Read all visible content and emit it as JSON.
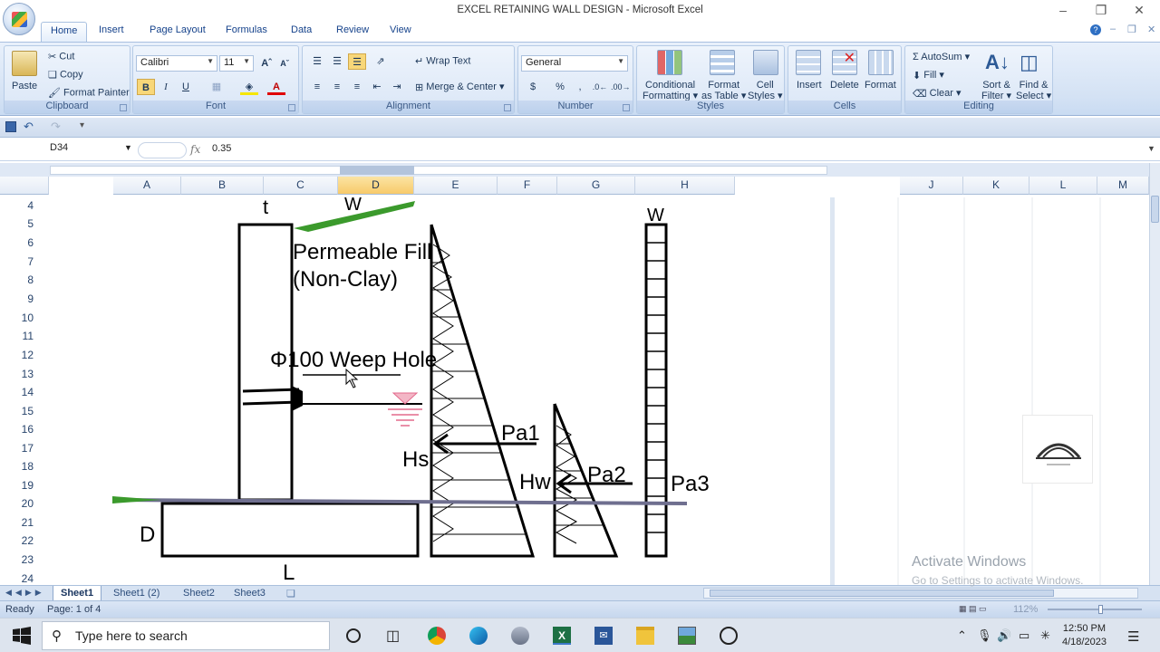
{
  "window": {
    "title": "EXCEL RETAINING WALL DESIGN - Microsoft Excel"
  },
  "ribbon_tabs": [
    "Home",
    "Insert",
    "Page Layout",
    "Formulas",
    "Data",
    "Review",
    "View"
  ],
  "clipboard": {
    "paste": "Paste",
    "cut": "Cut",
    "copy": "Copy",
    "format_painter": "Format Painter",
    "label": "Clipboard"
  },
  "font": {
    "name": "Calibri",
    "size": "11",
    "label": "Font",
    "bold": "B",
    "italic": "I",
    "underline": "U"
  },
  "alignment": {
    "wrap_text": "Wrap Text",
    "merge_center": "Merge & Center",
    "label": "Alignment"
  },
  "number": {
    "format": "General",
    "label": "Number",
    "currency": "$",
    "percent": "%",
    "comma": ","
  },
  "styles": {
    "conditional_1": "Conditional",
    "conditional_2": "Formatting",
    "format_table_1": "Format",
    "format_table_2": "as Table",
    "cell_styles_1": "Cell",
    "cell_styles_2": "Styles",
    "label": "Styles"
  },
  "cells": {
    "insert": "Insert",
    "delete": "Delete",
    "format": "Format",
    "label": "Cells"
  },
  "editing": {
    "autosum": "AutoSum",
    "fill": "Fill",
    "clear": "Clear",
    "sort_1": "Sort &",
    "sort_2": "Filter",
    "find_1": "Find &",
    "find_2": "Select",
    "label": "Editing"
  },
  "formula_bar": {
    "cell_ref": "D34",
    "fx": "fx",
    "value": "0.35"
  },
  "columns": [
    "A",
    "B",
    "C",
    "D",
    "E",
    "F",
    "G",
    "H",
    "J",
    "K",
    "L",
    "M"
  ],
  "selected_column": "D",
  "rows": [
    "4",
    "5",
    "6",
    "7",
    "8",
    "9",
    "10",
    "11",
    "12",
    "13",
    "14",
    "15",
    "16",
    "17",
    "18",
    "19",
    "20",
    "21",
    "22",
    "23",
    "24"
  ],
  "drawing": {
    "t": "t",
    "w_top": "W",
    "w_right": "W",
    "fill_1": "Permeable Fill",
    "fill_2": "(Non-Clay)",
    "weep": "Φ100 Weep Hole",
    "pa1": "Pa1",
    "pa2": "Pa2",
    "pa3": "Pa3",
    "hs": "Hs",
    "hw": "Hw",
    "d": "D",
    "l": "L"
  },
  "sheet_tabs": [
    "Sheet1",
    "Sheet1 (2)",
    "Sheet2",
    "Sheet3"
  ],
  "active_sheet": "Sheet1",
  "status": {
    "ready": "Ready",
    "page": "Page: 1 of 4",
    "zoom": "112%"
  },
  "watermark": {
    "line1": "Activate Windows",
    "line2": "Go to Settings to activate Windows."
  },
  "taskbar": {
    "search_placeholder": "Type here to search",
    "time": "12:50 PM",
    "date": "4/18/2023"
  }
}
